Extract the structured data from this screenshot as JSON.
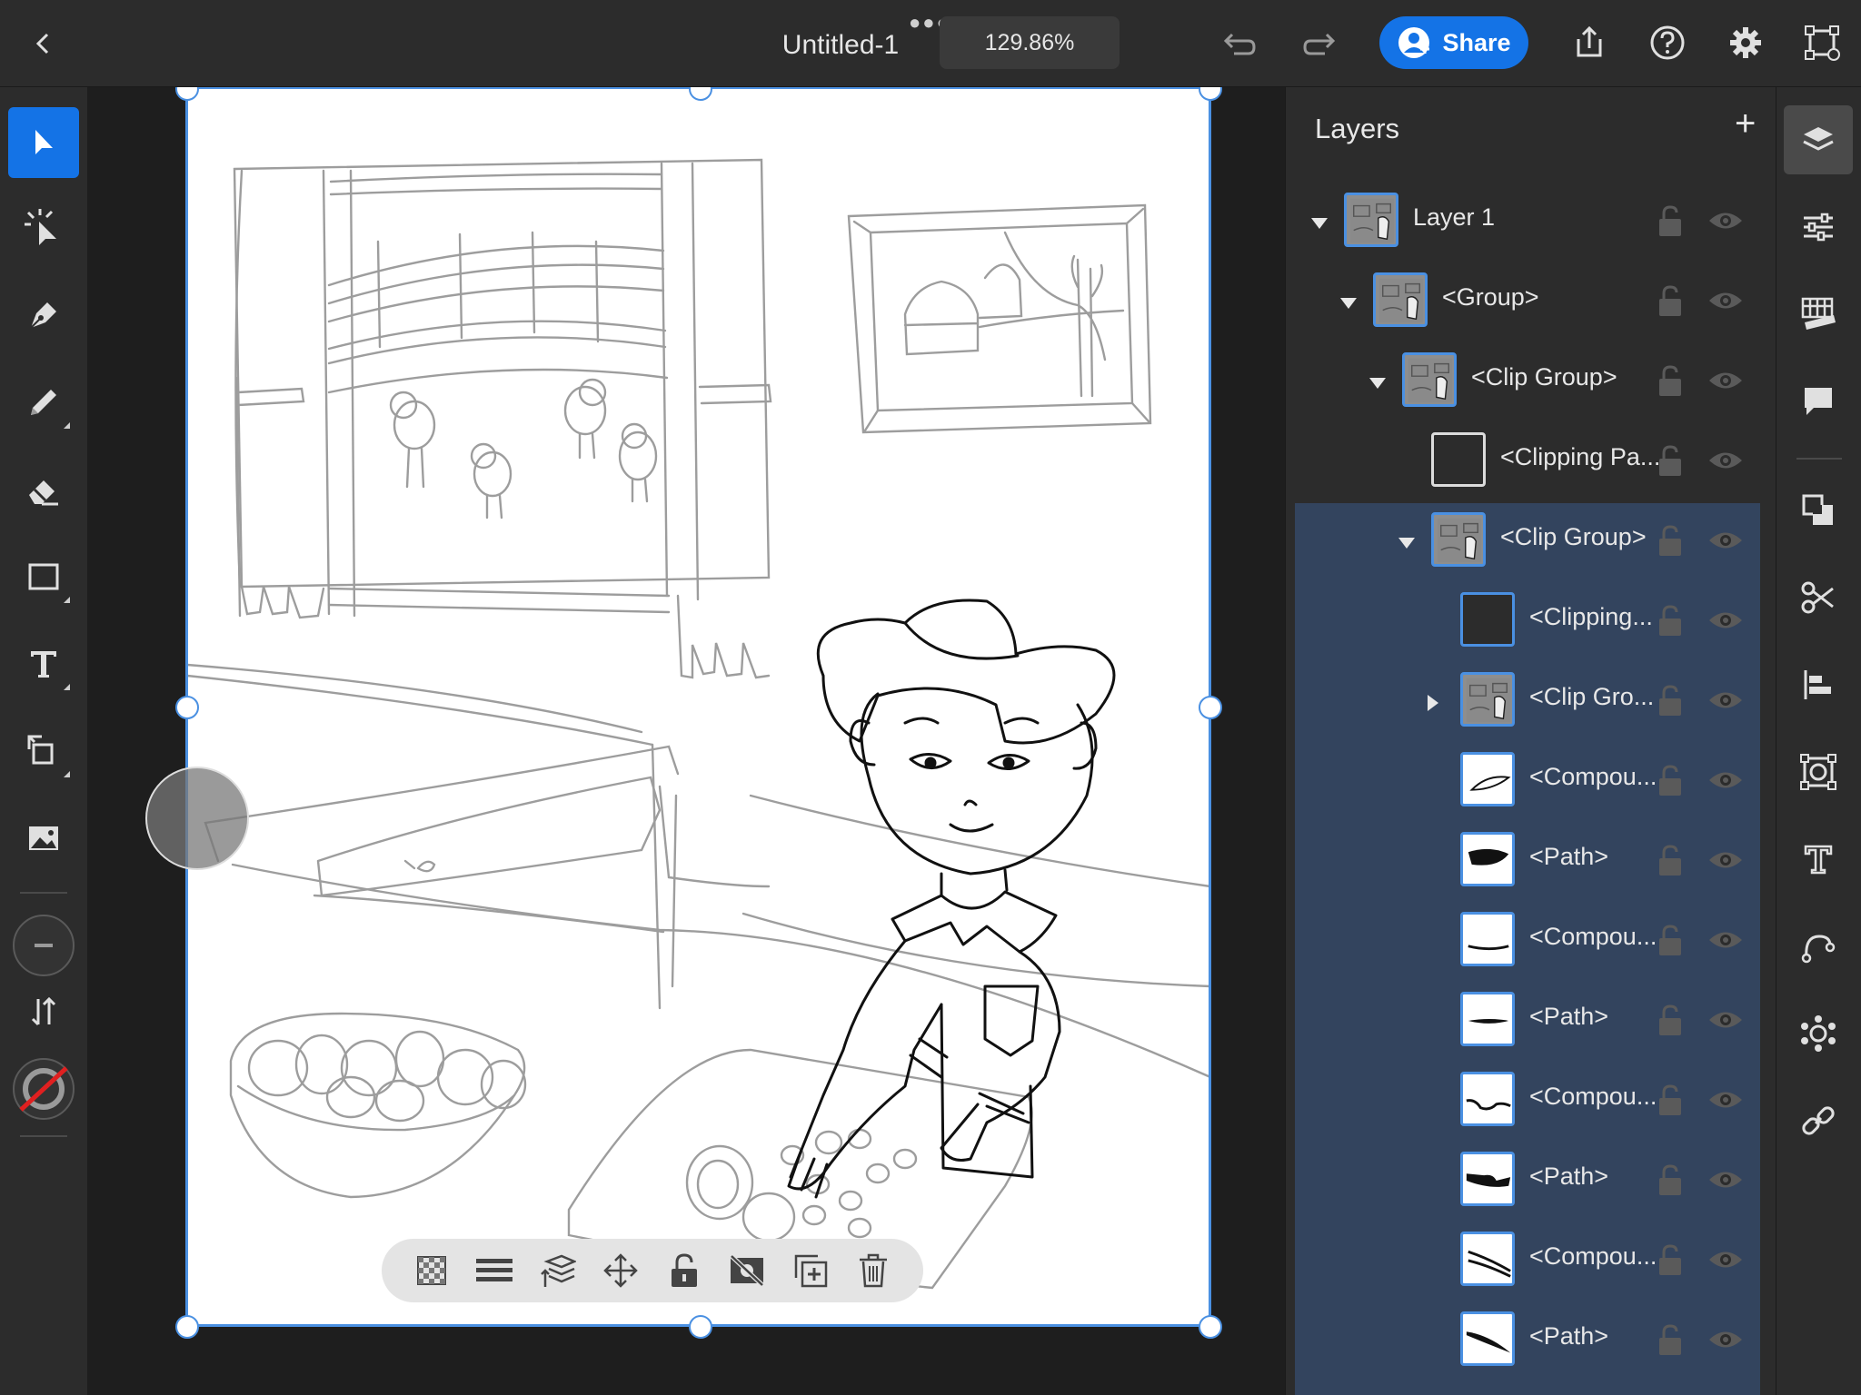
{
  "app": {
    "document_title": "Untitled-1",
    "zoom_level": "129.86%",
    "share_label": "Share"
  },
  "panel": {
    "title": "Layers"
  },
  "layers": [
    {
      "label": "Layer 1",
      "twisty": "open",
      "indent": 0,
      "thumb": "sketch"
    },
    {
      "label": "<Group>",
      "twisty": "open",
      "indent": 1,
      "thumb": "sketch"
    },
    {
      "label": "<Clip Group>",
      "twisty": "open",
      "indent": 2,
      "thumb": "sketch"
    },
    {
      "label": "<Clipping Pa...",
      "twisty": "none",
      "indent": 3,
      "thumb": "white"
    },
    {
      "label": "<Clip Group>",
      "twisty": "open",
      "indent": 3,
      "thumb": "sketch"
    },
    {
      "label": "<Clipping...",
      "twisty": "none",
      "indent": 4,
      "thumb": "empty"
    },
    {
      "label": "<Clip Gro...",
      "twisty": "closed",
      "indent": 4,
      "thumb": "sketch"
    },
    {
      "label": "<Compou...",
      "twisty": "none",
      "indent": 4,
      "thumb": "leaf"
    },
    {
      "label": "<Path>",
      "twisty": "none",
      "indent": 4,
      "thumb": "wing"
    },
    {
      "label": "<Compou...",
      "twisty": "none",
      "indent": 4,
      "thumb": "curve"
    },
    {
      "label": "<Path>",
      "twisty": "none",
      "indent": 4,
      "thumb": "stroke"
    },
    {
      "label": "<Compou...",
      "twisty": "none",
      "indent": 4,
      "thumb": "wave"
    },
    {
      "label": "<Path>",
      "twisty": "none",
      "indent": 4,
      "thumb": "blob"
    },
    {
      "label": "<Compou...",
      "twisty": "none",
      "indent": 4,
      "thumb": "lines"
    },
    {
      "label": "<Path>",
      "twisty": "none",
      "indent": 4,
      "thumb": "swoosh"
    }
  ],
  "colors": {
    "accent": "#1473e6",
    "selection": "#4a90e2",
    "panel_bg": "#2c2c2c",
    "row_highlight": "#33445e"
  },
  "icons": {
    "topbar": [
      "back-icon",
      "more-icon",
      "undo-icon",
      "redo-icon",
      "share-user-icon",
      "export-icon",
      "help-icon",
      "settings-icon",
      "artboard-icon"
    ],
    "left_tools": [
      "selection-tool-icon",
      "direct-selection-icon",
      "pen-tool-icon",
      "pencil-tool-icon",
      "eraser-tool-icon",
      "rectangle-tool-icon",
      "type-tool-icon",
      "transform-tool-icon",
      "image-tool-icon",
      "stroke-weight-icon",
      "swap-icon",
      "fill-stroke-icon"
    ],
    "context_bar": [
      "opacity-icon",
      "blend-icon",
      "arrange-icon",
      "move-icon",
      "lock-icon",
      "hide-icon",
      "duplicate-icon",
      "delete-icon"
    ],
    "right_tools": [
      "layers-icon",
      "properties-icon",
      "grid-ruler-icon",
      "comment-icon",
      "pathfinder-icon",
      "cut-icon",
      "align-icon",
      "image-trace-icon",
      "type-panel-icon",
      "path-icon",
      "repeat-icon",
      "link-icon"
    ]
  }
}
